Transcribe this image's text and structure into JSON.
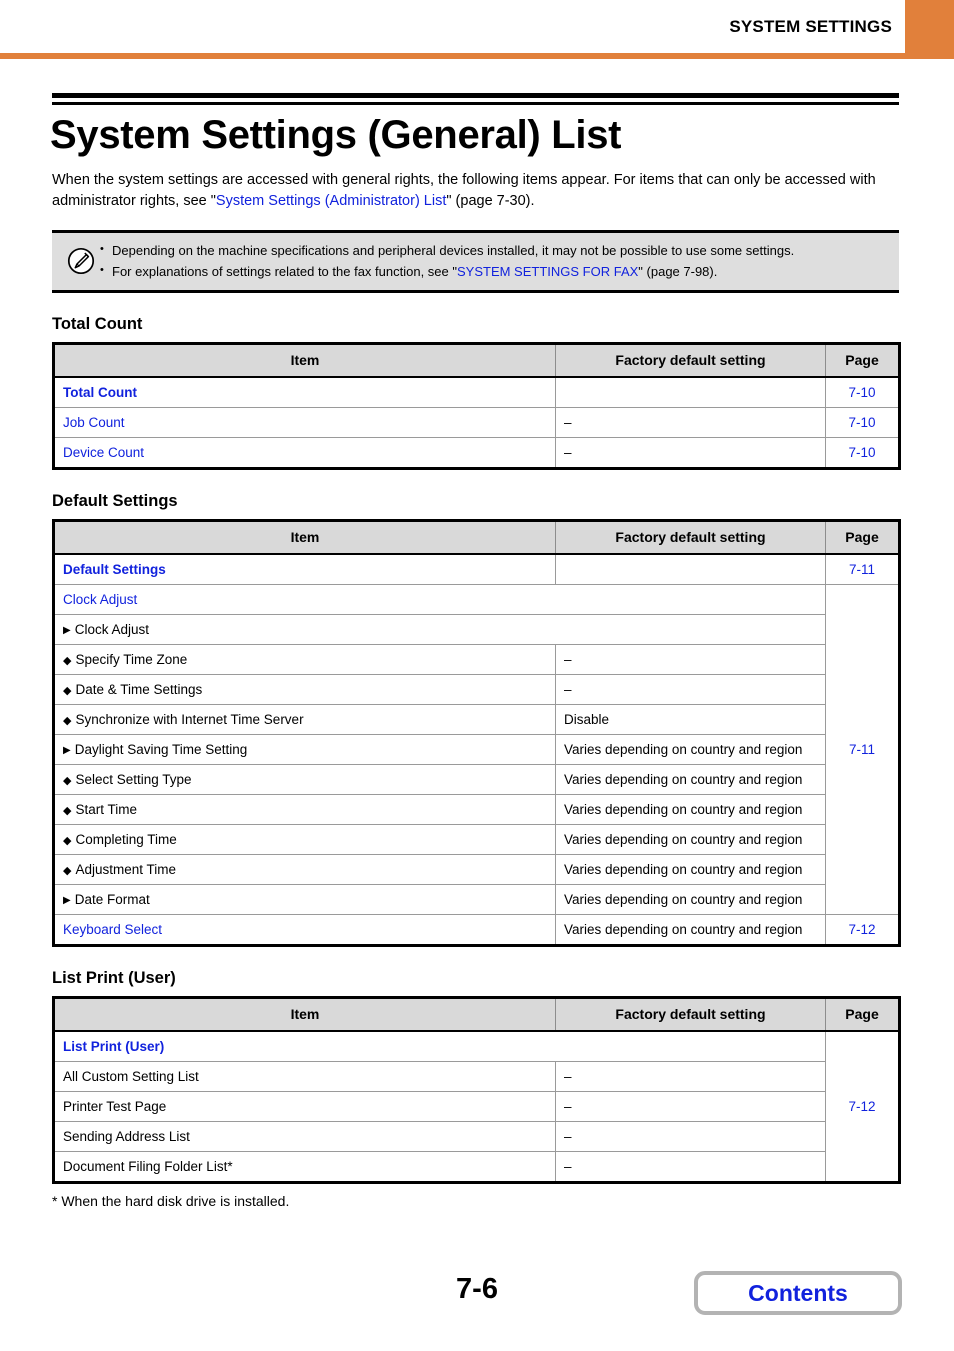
{
  "header": {
    "running_title": "SYSTEM SETTINGS"
  },
  "doc": {
    "title": "System Settings (General) List",
    "intro_part1": "When the system settings are accessed with general rights, the following items appear. For items that can only be accessed with administrator rights, see \"",
    "intro_link": "System Settings (Administrator) List",
    "intro_part2": "\" (page 7-30)."
  },
  "note": {
    "icon": "pencil-note-icon",
    "bullet": "•",
    "line1": "Depending on the machine specifications and peripheral devices installed, it may not be possible to use some settings.",
    "line2_part1": "For explanations of settings related to the fax function, see \"",
    "line2_link": "SYSTEM SETTINGS FOR FAX",
    "line2_part2": "\" (page 7-98)."
  },
  "table_headers": {
    "item": "Item",
    "default": "Factory default setting",
    "page": "Page"
  },
  "sections": [
    {
      "heading": "Total Count",
      "rows": [
        {
          "item": "Total Count",
          "level": 0,
          "marker": "",
          "default": "",
          "page": "7-10"
        },
        {
          "item": "Job Count",
          "level": 1,
          "marker": "",
          "default": "–",
          "page": "7-10"
        },
        {
          "item": "Device Count",
          "level": 1,
          "marker": "",
          "default": "–",
          "page": "7-10"
        }
      ]
    },
    {
      "heading": "Default Settings",
      "rows": [
        {
          "item": "Default Settings",
          "level": 0,
          "marker": "",
          "default": "",
          "page": "7-11"
        },
        {
          "item": "Clock Adjust",
          "level": 1,
          "marker": "",
          "default": "",
          "page": ""
        },
        {
          "item": "Clock Adjust",
          "level": 2,
          "marker": "▶",
          "default": "",
          "page": ""
        },
        {
          "item": "Specify Time Zone",
          "level": 3,
          "marker": "◆",
          "default": "–",
          "page": ""
        },
        {
          "item": "Date & Time Settings",
          "level": 3,
          "marker": "◆",
          "default": "–",
          "page": ""
        },
        {
          "item": "Synchronize with Internet Time Server",
          "level": 3,
          "marker": "◆",
          "default": "Disable",
          "page": ""
        },
        {
          "item": "Daylight Saving Time Setting",
          "level": 2,
          "marker": "▶",
          "default": "Varies depending on country and region",
          "page": "7-11"
        },
        {
          "item": "Select Setting Type",
          "level": 3,
          "marker": "◆",
          "default": "Varies depending on country and region",
          "page": ""
        },
        {
          "item": "Start Time",
          "level": 3,
          "marker": "◆",
          "default": "Varies depending on country and region",
          "page": ""
        },
        {
          "item": "Completing Time",
          "level": 3,
          "marker": "◆",
          "default": "Varies depending on country and region",
          "page": ""
        },
        {
          "item": "Adjustment Time",
          "level": 3,
          "marker": "◆",
          "default": "Varies depending on country and region",
          "page": ""
        },
        {
          "item": "Date Format",
          "level": 2,
          "marker": "▶",
          "default": "Varies depending on country and region",
          "page": ""
        },
        {
          "item": "Keyboard Select",
          "level": 1,
          "marker": "",
          "default": "Varies depending on country and region",
          "page": "7-12"
        }
      ]
    },
    {
      "heading": "List Print (User)",
      "rows": [
        {
          "item": "List Print (User)",
          "level": 0,
          "marker": "",
          "default": "",
          "page": "7-12"
        },
        {
          "item": "All Custom Setting List",
          "level": 1,
          "marker": "",
          "default": "–",
          "page": ""
        },
        {
          "item": "Printer Test Page",
          "level": 1,
          "marker": "",
          "default": "–",
          "page": ""
        },
        {
          "item": "Sending Address List",
          "level": 1,
          "marker": "",
          "default": "–",
          "page": ""
        },
        {
          "item": "Document Filing Folder List*",
          "level": 1,
          "marker": "",
          "default": "–",
          "page": ""
        }
      ]
    }
  ],
  "footnote": "*  When the hard disk drive is installed.",
  "footer": {
    "folio": "7-6",
    "contents_label": "Contents"
  },
  "colors": {
    "accent_orange": "#e1803b",
    "link_blue": "#1122dd",
    "header_fill": "#d9d9d9",
    "note_fill": "#dedede"
  }
}
